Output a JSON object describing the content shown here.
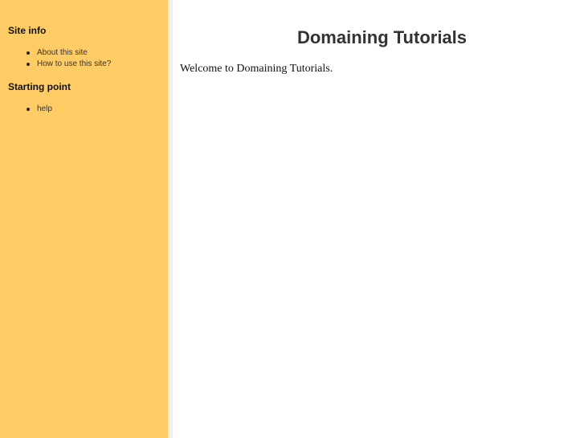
{
  "sidebar": {
    "sections": [
      {
        "heading": "Site info",
        "items": [
          {
            "label": "About this site"
          },
          {
            "label": "How to use this site?"
          }
        ]
      },
      {
        "heading": "Starting point",
        "items": [
          {
            "label": "help"
          }
        ]
      }
    ],
    "background": "#ffcc66"
  },
  "main": {
    "title": "Domaining Tutorials",
    "welcome": "Welcome to Domaining Tutorials."
  }
}
